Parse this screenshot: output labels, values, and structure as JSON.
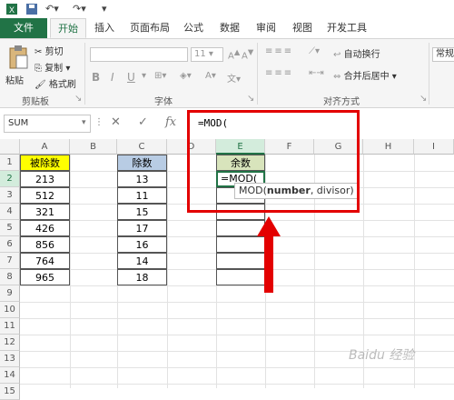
{
  "ribbon_tabs": [
    "文件",
    "开始",
    "插入",
    "页面布局",
    "公式",
    "数据",
    "审阅",
    "视图",
    "开发工具"
  ],
  "clipboard": {
    "cut": "剪切",
    "copy": "复制",
    "format_painter": "格式刷",
    "paste": "粘贴",
    "label": "剪贴板"
  },
  "font": {
    "size": "11",
    "bold": "B",
    "italic": "I",
    "underline": "U",
    "label": "字体"
  },
  "alignment": {
    "wrap": "自动换行",
    "merge": "合并后居中",
    "label": "对齐方式"
  },
  "number": {
    "format": "常规"
  },
  "formula_bar": {
    "name_box": "SUM",
    "fx": "fx",
    "formula": "=MOD("
  },
  "columns": [
    "A",
    "B",
    "C",
    "D",
    "E",
    "F",
    "G",
    "H",
    "I"
  ],
  "rows": [
    "1",
    "2",
    "3",
    "4",
    "5",
    "6",
    "7",
    "8",
    "9",
    "10",
    "11",
    "12",
    "13",
    "14",
    "15"
  ],
  "sheet": {
    "a_header": "被除数",
    "a_values": [
      "213",
      "512",
      "321",
      "426",
      "856",
      "764",
      "965"
    ],
    "c_header": "除数",
    "c_values": [
      "13",
      "11",
      "15",
      "17",
      "16",
      "14",
      "18"
    ],
    "e_header": "余数",
    "e2_value": "=MOD("
  },
  "tooltip": {
    "func": "MOD(",
    "arg1": "number",
    "rest": ", divisor)"
  },
  "watermark": "Baidu 经验",
  "colors": {
    "excel_green": "#217346",
    "header_yellow": "#ffff00",
    "header_blue": "#b8cce4",
    "header_olive": "#d8e4bc",
    "highlight_red": "#e30000"
  }
}
